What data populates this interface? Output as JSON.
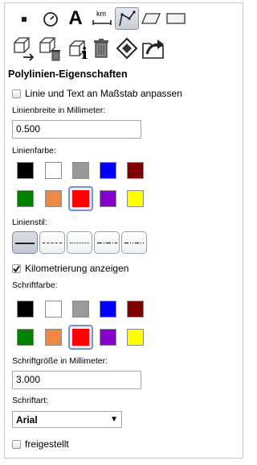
{
  "toolbar": {
    "tools": [
      {
        "icon": "point-icon"
      },
      {
        "icon": "clock-icon"
      },
      {
        "icon": "text-tool-icon",
        "glyph": "A"
      },
      {
        "icon": "scale-bar-icon",
        "unit": "km"
      },
      {
        "icon": "polyline-tool-icon",
        "active": true
      },
      {
        "icon": "polygon-tool-icon"
      },
      {
        "icon": "rectangle-tool-icon"
      }
    ],
    "actions": [
      {
        "icon": "move-object-icon"
      },
      {
        "icon": "delete-object-icon"
      },
      {
        "icon": "object-info-icon",
        "glyph": "i"
      },
      {
        "icon": "trash-icon"
      },
      {
        "icon": "eraser-icon"
      },
      {
        "icon": "export-icon"
      }
    ]
  },
  "panel": {
    "title": "Polylinien-Eigenschaften",
    "fit_scale": {
      "label": "Linie und Text an Maßstab anpassen",
      "checked": false
    },
    "line_width": {
      "label": "Linienbreite in Millimeter:",
      "value": "0.500"
    },
    "line_color": {
      "label": "Linienfarbe:",
      "selected": "#ff0000"
    },
    "line_style": {
      "label": "Linienstil:",
      "options": [
        "solid",
        "dashed",
        "dotted",
        "dash-dot",
        "dash-dot-dot"
      ],
      "selected": "solid"
    },
    "kilometering": {
      "label": "Kilometrierung anzeigen",
      "checked": true
    },
    "font_color": {
      "label": "Schriftfarbe:",
      "selected": "#ff0000"
    },
    "font_size": {
      "label": "Schriftgröße in Millimeter:",
      "value": "3.000"
    },
    "font_family": {
      "label": "Schriftart:",
      "value": "Arial"
    },
    "free_standing": {
      "label": "freigestellt",
      "checked": false
    }
  },
  "palette": [
    "#000000",
    "#ffffff",
    "#999999",
    "#0000ff",
    "#800000",
    "#008000",
    "#ee8844",
    "#ff0000",
    "#8800cc",
    "#ffff00"
  ]
}
